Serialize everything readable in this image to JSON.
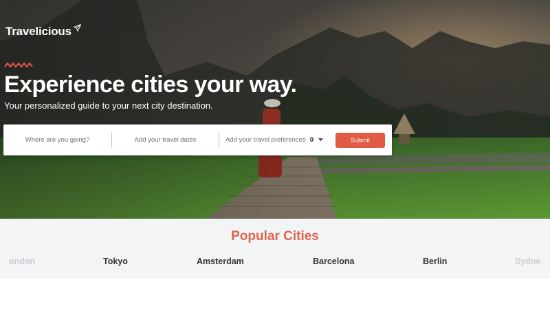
{
  "brand": {
    "name": "Travelicious",
    "icon": "airplane-icon",
    "accent": "#e05a45"
  },
  "hero": {
    "headline": "Experience cities your way.",
    "subheadline": "Your personalized guide to your next city destination."
  },
  "search": {
    "destination_placeholder": "Where are you going?",
    "dates_placeholder": "Add your travel dates",
    "preferences_placeholder": "Add your travel preferences",
    "preferences_count": "0",
    "submit_label": "Submit"
  },
  "popular": {
    "title": "Popular Cities",
    "cities": [
      "ondon",
      "Tokyo",
      "Amsterdam",
      "Barcelona",
      "Berlin",
      "Sydne"
    ]
  }
}
